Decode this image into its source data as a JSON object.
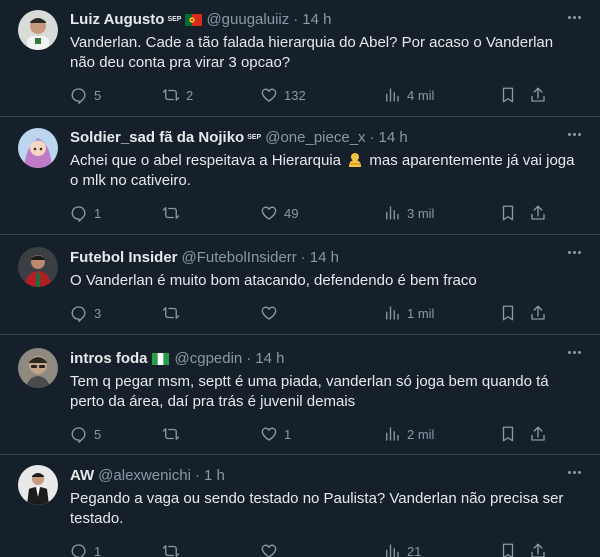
{
  "tweets": [
    {
      "name": "Luiz Augusto",
      "suffix": "SEP",
      "handle": "@guugaluiiz",
      "sep": "·",
      "time": "14 h",
      "text": "Vanderlan. Cade a tão falada hierarquia do Abel? Por acaso o Vanderlan não deu conta pra virar 3 opcao?",
      "replies": "5",
      "retweets": "2",
      "likes": "132",
      "views": "4 mil"
    },
    {
      "name": "Soldier_sad fã da Nojiko",
      "suffix": "SEP",
      "handle": "@one_piece_x",
      "sep": "·",
      "time": "14 h",
      "text_before": "Achei que o abel respeitava a Hierarquia",
      "text_after": "mas aparentemente já vai joga o mlk no cativeiro.",
      "replies": "1",
      "retweets": "",
      "likes": "49",
      "views": "3 mil"
    },
    {
      "name": "Futebol Insider",
      "handle": "@FutebolInsiderr",
      "sep": "·",
      "time": "14 h",
      "text": "O Vanderlan é muito bom atacando, defendendo é bem fraco",
      "replies": "3",
      "retweets": "",
      "likes": "",
      "views": "1 mil"
    },
    {
      "name": "intros foda",
      "handle": "@cgpedin",
      "sep": "·",
      "time": "14 h",
      "text": "Tem q pegar msm, septt é uma piada, vanderlan só joga bem quando tá perto da área, daí  pra trás é juvenil demais",
      "replies": "5",
      "retweets": "",
      "likes": "1",
      "views": "2 mil"
    },
    {
      "name": "AW",
      "handle": "@alexwenichi",
      "sep": "·",
      "time": "1 h",
      "text": "Pegando a vaga ou sendo testado no Paulista? Vanderlan não precisa ser testado.",
      "replies": "1",
      "retweets": "",
      "likes": "",
      "views": "21"
    }
  ],
  "icons": {
    "reply": "reply-icon",
    "retweet": "retweet-icon",
    "like": "heart-icon",
    "views": "views-icon",
    "bookmark": "bookmark-icon",
    "share": "share-icon",
    "more": "more-icon"
  },
  "colors": {
    "background": "#15202b",
    "text": "#e7e9ea",
    "muted": "#8b98a5",
    "divider": "#38444d"
  }
}
